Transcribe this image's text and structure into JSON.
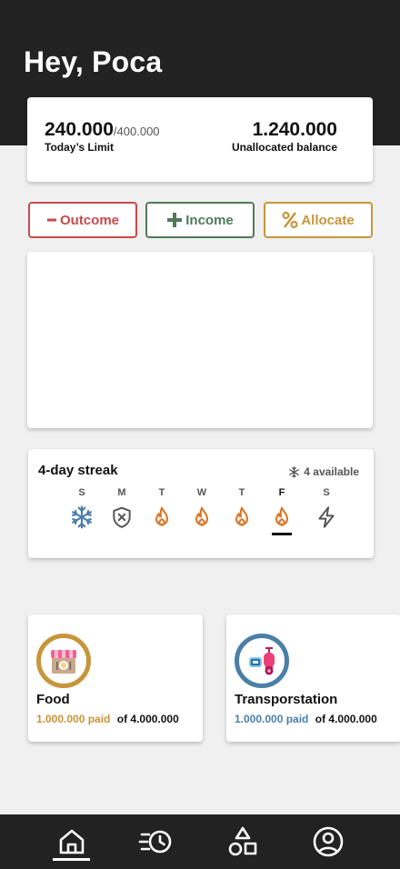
{
  "header": {
    "greeting": "Hey, Poca"
  },
  "summary": {
    "today_limit_value": "240.000",
    "today_limit_max": "/400.000",
    "today_limit_label": "Today’s Limit",
    "unallocated_value": "1.240.000",
    "unallocated_label": "Unallocated balance"
  },
  "actions": [
    {
      "label": "Outcome",
      "icon": "minus-icon",
      "color": "#c84a4a"
    },
    {
      "label": "Income",
      "icon": "plus-icon",
      "color": "#4e7a5a"
    },
    {
      "label": "Allocate",
      "icon": "percent-icon",
      "color": "#c7953a"
    }
  ],
  "streak": {
    "title": "4-day streak",
    "freeze_available": "4 available",
    "days": [
      {
        "label": "S",
        "status": "freeze",
        "icon": "snowflake-icon"
      },
      {
        "label": "M",
        "status": "missed",
        "icon": "shield-x-icon"
      },
      {
        "label": "T",
        "status": "done",
        "icon": "flame-icon"
      },
      {
        "label": "W",
        "status": "done",
        "icon": "flame-icon"
      },
      {
        "label": "T",
        "status": "done",
        "icon": "flame-icon"
      },
      {
        "label": "F",
        "status": "today",
        "icon": "flame-icon"
      },
      {
        "label": "S",
        "status": "upcoming",
        "icon": "lightning-icon"
      }
    ]
  },
  "categories": [
    {
      "name": "Food",
      "paid": "1.000.000 paid",
      "total": "of 4.000.000",
      "color": "#c7953a",
      "icon": "storefront-icon"
    },
    {
      "name": "Transporstation",
      "paid": "1.000.000 paid",
      "total": "of 4.000.000",
      "color": "#4a7fa8",
      "icon": "scooter-icon"
    }
  ],
  "nav": {
    "items": [
      {
        "name": "home",
        "icon": "home-icon",
        "active": true
      },
      {
        "name": "history",
        "icon": "history-icon",
        "active": false
      },
      {
        "name": "categories",
        "icon": "shapes-icon",
        "active": false
      },
      {
        "name": "profile",
        "icon": "profile-icon",
        "active": false
      }
    ]
  },
  "colors": {
    "header_bg": "#222222",
    "page_bg": "#f0f0f0",
    "flame": "#d97b2a",
    "snowflake": "#4a7fa8"
  }
}
